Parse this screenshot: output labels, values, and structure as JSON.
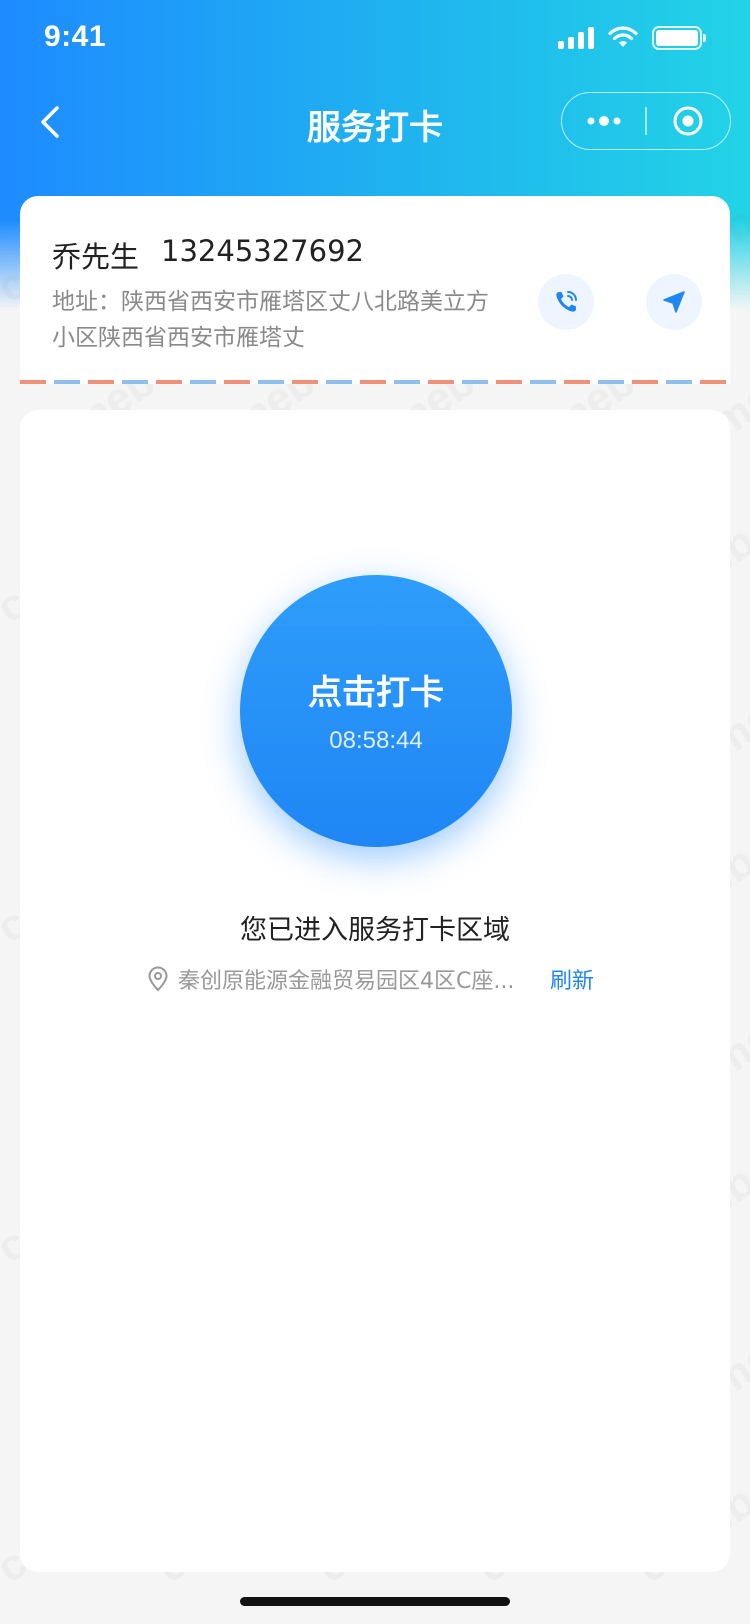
{
  "status_bar": {
    "time": "9:41"
  },
  "nav": {
    "title": "服务打卡"
  },
  "customer": {
    "name": "乔先生",
    "phone": "13245327692",
    "address": "地址：陕西省西安市雁塔区丈八北路美立方小区陕西省西安市雁塔丈"
  },
  "checkin": {
    "label": "点击打卡",
    "time": "08:58:44",
    "zone_status": "您已进入服务打卡区域",
    "location": "秦创原能源金融贸易园区4区C座...",
    "refresh_label": "刷新"
  },
  "colors": {
    "primary": "#1f86f4",
    "header_start": "#1e8bff",
    "header_end": "#22d3e6",
    "text_dark": "#222222",
    "text_gray": "#8a8a8a"
  },
  "icons": [
    "back-chevron-icon",
    "more-dots-icon",
    "close-target-icon",
    "phone-icon",
    "navigation-arrow-icon",
    "location-pin-icon"
  ],
  "watermark": "crmeb"
}
